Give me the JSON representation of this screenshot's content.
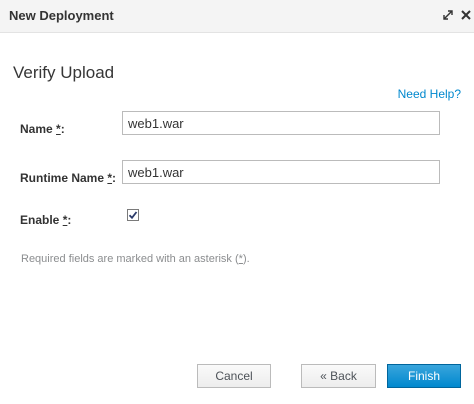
{
  "dialog": {
    "title": "New Deployment",
    "maximize_icon": "maximize-icon",
    "close_icon": "close-icon"
  },
  "step": {
    "heading": "Verify Upload",
    "help_link": "Need Help?"
  },
  "form": {
    "name": {
      "label": "Name",
      "required_mark": "*",
      "suffix": ":",
      "value": "web1.war"
    },
    "runtime_name": {
      "label": "Runtime Name",
      "required_mark": "*",
      "suffix": ":",
      "value": "web1.war"
    },
    "enable": {
      "label": "Enable",
      "required_mark": "*",
      "suffix": ":",
      "checked": true,
      "check_icon": "checkmark-icon"
    }
  },
  "note": {
    "prefix": "Required fields are marked with an asterisk (",
    "mark": "*",
    "suffix": ")."
  },
  "buttons": {
    "cancel": "Cancel",
    "back": "« Back",
    "finish": "Finish"
  },
  "colors": {
    "accent": "#0088ce",
    "primary_button": "#0088ce",
    "titlebar_bg": "#f4f4f4",
    "note_text": "#8b8d8f"
  }
}
